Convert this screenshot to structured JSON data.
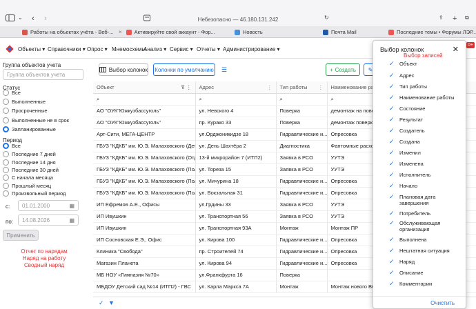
{
  "browser": {
    "url": "Небезопасно — 46.180.131.242",
    "tabs": [
      {
        "label": "Работы на объектах учёта - Веб-...",
        "color": "#d9534f"
      },
      {
        "label": "Активируйте свой аккаунт - Фор...",
        "color": "#e55"
      },
      {
        "label": "Новость",
        "color": "#4a90d9"
      },
      {
        "label": "Почта Mail",
        "color": "#1e5aa8"
      },
      {
        "label": "Последние темы • Форумы ЛЭР...",
        "color": "#e55"
      }
    ]
  },
  "nav": {
    "items": [
      "Объекты",
      "Справочники",
      "Опрос",
      "Мнемосхемы",
      "Анализ",
      "Сервис",
      "Отчеты",
      "Администрирование"
    ],
    "badge": "0+"
  },
  "left": {
    "group_label": "Группа объектов учета",
    "group_placeholder": "Группа объектов учета",
    "status_label": "Статус",
    "statuses": [
      "Все",
      "Выполненные",
      "Просроченные",
      "Выполненные не в срок",
      "Запланированные"
    ],
    "period_label": "Период",
    "periods": [
      "Все",
      "Последние 7 дней",
      "Последние 14 дня",
      "Последние 30 дней",
      "С начала месяца",
      "Прошлый месяц",
      "Произвольный период"
    ],
    "from_label": "с:",
    "from_date": "01.01.2000",
    "to_label": "по:",
    "to_date": "14.08.2026",
    "apply": "Применить",
    "links": [
      "Отчет по нарядам",
      "Наряд на работу",
      "Сводный наряд"
    ]
  },
  "toolbar": {
    "choose_columns": "Выбор колонок",
    "default_columns": "Колонки по умолчанию",
    "create": "Создать"
  },
  "table": {
    "headers": [
      "Объект",
      "Адрес",
      "Тип работы",
      "Наименование работ"
    ],
    "rows": [
      [
        "АО \"ОУК\"Южкузбассуголь\"",
        "ул. Невского 4",
        "Поверка",
        "демонтаж на поверк"
      ],
      [
        "АО \"ОУК\"Южкузбассуголь\"",
        "пр. Курако 33",
        "Поверка",
        "демонтаж поверка"
      ],
      [
        "Арт-Сити, МЕГА-ЦЕНТР",
        "ул.Орджоникидзе 18",
        "Гидравлические и...",
        "Опресовка"
      ],
      [
        "ГБУЗ \"КДКБ\" им. Ю.Э. Малаховского (Дет...",
        "ул. День Шахтёра 2",
        "Диагностика",
        "Фантомные расход"
      ],
      [
        "ГБУЗ \"КДКБ\" им. Ю.Э. Малаховского (Отд...",
        "13-й микрорайон 7 (ИТП2)",
        "Заявка в РСО",
        "УУТЭ"
      ],
      [
        "ГБУЗ \"КДКБ\" им. Ю.Э. Малаховского (Пол...",
        "ул. Тореза 15",
        "Заявка в РСО",
        "УУТЭ"
      ],
      [
        "ГБУЗ \"КДКБ\" им. Ю.Э. Малаховского (Пол...",
        "ул. Мичурина 18",
        "Гидравлические и...",
        "Опресовка"
      ],
      [
        "ГБУЗ \"КДКБ\" им. Ю.Э. Малаховского (Пол...",
        "ул. Вокзальная 31",
        "Гидравлические и...",
        "Опресовка"
      ],
      [
        "ИП Ефремов А.Е., Офисы",
        "ул.Грдины 33",
        "Заявка в РСО",
        "УУТЭ"
      ],
      [
        "ИП Ивушкин",
        "ул. Транспортная 56",
        "Заявка в РСО",
        "УУТЭ"
      ],
      [
        "ИП Ивушкин",
        "ул. Транспортная 93А",
        "Монтаж",
        "Монтаж ПР"
      ],
      [
        "ИП Сосновская Е.Э., Офис",
        "ул. Кирова 100",
        "Гидравлические и...",
        "Опресовка"
      ],
      [
        "Клиника \"Свобода\"",
        "пр. Строителей 74",
        "Гидравлические и...",
        "Опресовка"
      ],
      [
        "Магазин Планета",
        "ул. Кирова 94",
        "Гидравлические и...",
        "Опресовка"
      ],
      [
        "МБ НОУ «Гимназия №70»",
        "ул.Франкфурта 16",
        "Поверка",
        ""
      ],
      [
        "МБДОУ Детский сад №14 (ИТП2) - ГВС",
        "ул. Карла Маркса 7А",
        "Монтаж",
        "Монтаж нового ВСЧ"
      ]
    ]
  },
  "panel": {
    "title": "Выбор колонок",
    "subtitle": "Выбор записей",
    "columns": [
      "Объект",
      "Адрес",
      "Тип работы",
      "Наименование работы",
      "Состояние",
      "Результат",
      "Создатель",
      "Создана",
      "Изменил",
      "Изменена",
      "Исполнитель",
      "Начало",
      "Плановая дата завершения",
      "Потребитель",
      "Обслуживающая организация",
      "Выполнена",
      "Нештатная ситуация",
      "Наряд",
      "Описание",
      "Комментарии"
    ],
    "clear": "Очистить"
  },
  "colors": {
    "accent": "#1a73e8",
    "red": "#e03030",
    "green": "#2e9e4f"
  }
}
